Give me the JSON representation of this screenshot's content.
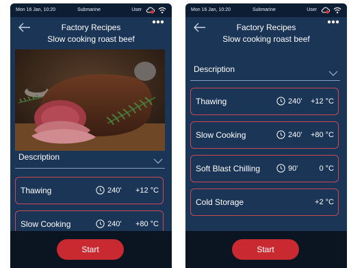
{
  "status_bar": {
    "time": "Mon 16 Jan, 10:20",
    "carrier": "Submarine",
    "user": "User"
  },
  "header": {
    "app_title": "Factory Recipes",
    "recipe_title": "Slow cooking roast beef"
  },
  "description": {
    "label": "Description"
  },
  "steps": [
    {
      "name": "Thawing",
      "time": "240'",
      "temp": "+12 °C"
    },
    {
      "name": "Slow Cooking",
      "time": "240'",
      "temp": "+80 °C"
    },
    {
      "name": "Soft Blast Chilling",
      "time": "90'",
      "temp": "0 °C"
    },
    {
      "name": "Cold Storage",
      "time": "",
      "temp": "+2 °C"
    }
  ],
  "actions": {
    "start_label": "Start"
  },
  "colors": {
    "background": "#1b3557",
    "status_bar": "#0d1e34",
    "card_border": "#c94a56",
    "accent": "#c92a32",
    "bottom_bar": "#0b1522"
  }
}
